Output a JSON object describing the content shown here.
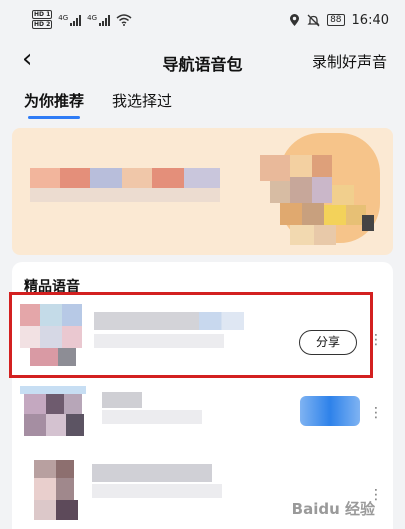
{
  "status_bar": {
    "sim1": "HD 1",
    "sim2": "HD 2",
    "net1": "4G",
    "net2": "4G",
    "battery": "88",
    "time": "16:40",
    "icons": [
      "location-icon",
      "mute-icon",
      "wifi-icon"
    ]
  },
  "nav": {
    "back_icon": "‹",
    "title": "导航语音包",
    "record_label": "录制好声音"
  },
  "tabs": [
    {
      "label": "为你推荐",
      "active": true
    },
    {
      "label": "我选择过",
      "active": false
    }
  ],
  "section": {
    "title": "精品语音"
  },
  "items": [
    {
      "action_label": "分享",
      "more_icon": "⋮"
    },
    {
      "action_label": "",
      "more_icon": "⋮"
    },
    {
      "action_label": "",
      "more_icon": "⋮"
    }
  ],
  "watermark": "Baidu 经验",
  "colors": {
    "accent": "#2f7cf6",
    "highlight": "#d32020",
    "banner_bg": "#fbe9d3"
  }
}
